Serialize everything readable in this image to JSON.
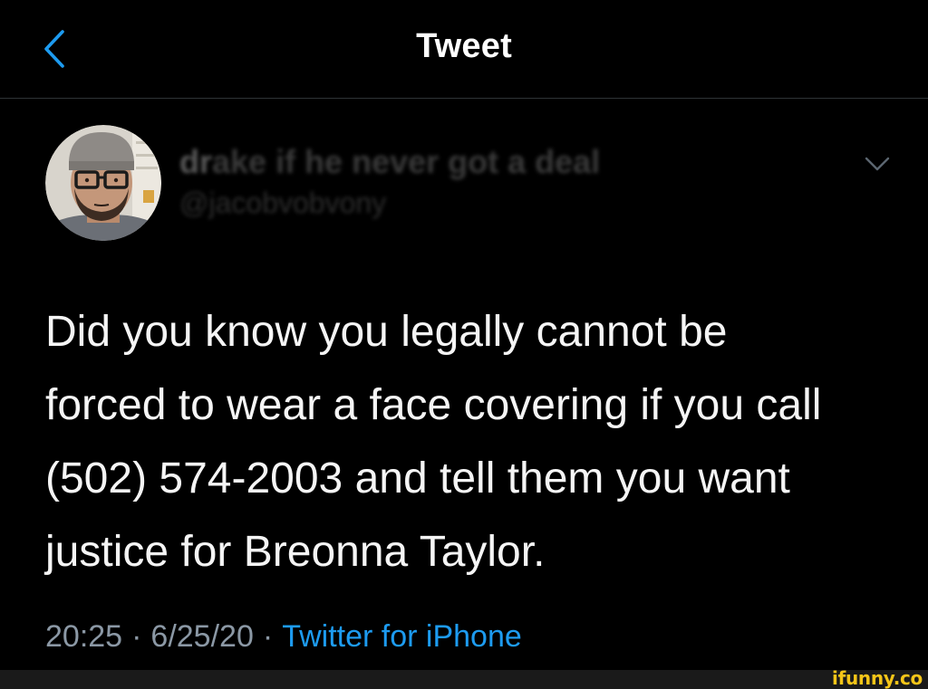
{
  "nav": {
    "title": "Tweet",
    "back_icon": "chevron-left-icon"
  },
  "author": {
    "display_name_visible": "dr",
    "display_name_obscured": "ake if he never got a deal",
    "handle": "@jacobvobvony",
    "menu_icon": "chevron-down-icon"
  },
  "tweet": {
    "lines": [
      "Did you know you legally cannot be",
      "forced to wear a face covering if you call",
      "(502) 574-2003 and tell them you want",
      "justice for Breonna Taylor."
    ]
  },
  "meta": {
    "time": "20:25",
    "separator": "·",
    "date": "6/25/20",
    "source": "Twitter for iPhone"
  },
  "watermark": "ifunny.co",
  "colors": {
    "background": "#000000",
    "accent": "#1d9bf0",
    "meta_gray": "#8b98a5",
    "divider": "#2f3336",
    "watermark": "#f5c518"
  }
}
